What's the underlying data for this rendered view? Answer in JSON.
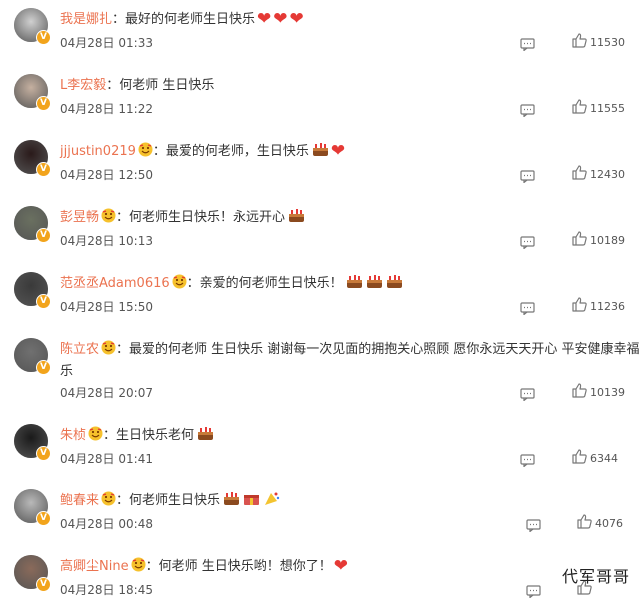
{
  "comments": [
    {
      "username": "我是娜扎",
      "text": "最好的何老师生日快乐",
      "date": "04月28日",
      "time": "01:33",
      "likes": "11530",
      "avatar_color": "#d0d0d0",
      "icons": [
        "heart",
        "heart",
        "heart"
      ],
      "badge": false
    },
    {
      "username": "L李宏毅",
      "text": "何老师 生日快乐",
      "date": "04月28日",
      "time": "11:22",
      "likes": "11555",
      "avatar_color": "#c5b0a0",
      "icons": [],
      "badge": false
    },
    {
      "username": "jjjustin0219",
      "text": "最爱的何老师，生日快乐",
      "date": "04月28日",
      "time": "12:50",
      "likes": "12430",
      "avatar_color": "#2a1a1a",
      "icons": [
        "cake",
        "heart"
      ],
      "badge": true
    },
    {
      "username": "彭昱畅",
      "text": "何老师生日快乐！永远开心",
      "date": "04月28日",
      "time": "10:13",
      "likes": "10189",
      "avatar_color": "#6a7060",
      "icons": [
        "cake"
      ],
      "badge": true
    },
    {
      "username": "范丞丞Adam0616",
      "text": "亲爱的何老师生日快乐！",
      "date": "04月28日",
      "time": "15:50",
      "likes": "11236",
      "avatar_color": "#3a3a3a",
      "icons": [
        "cake",
        "cake",
        "cake"
      ],
      "badge": true
    },
    {
      "username": "陈立农",
      "text": "最爱的何老师 生日快乐 谢谢每一次见面的拥抱关心照顾 愿你永远天天开心 平安健康幸福快",
      "text_wrap": "乐",
      "date": "04月28日",
      "time": "20:07",
      "likes": "10139",
      "avatar_color": "#707070",
      "icons": [],
      "badge": true
    },
    {
      "username": "朱桢",
      "text": "生日快乐老何",
      "date": "04月28日",
      "time": "01:41",
      "likes": "6344",
      "avatar_color": "#1a1a1a",
      "icons": [
        "cake"
      ],
      "badge": true
    },
    {
      "username": "鲍春来",
      "text": "何老师生日快乐",
      "date": "04月28日",
      "time": "00:48",
      "likes": "4076",
      "avatar_color": "#b9b9b9",
      "icons": [
        "cake",
        "gift",
        "party"
      ],
      "badge": true
    },
    {
      "username": "高卿尘Nine",
      "text": "何老师 生日快乐哟！想你了！",
      "date": "04月28日",
      "time": "18:45",
      "likes": "",
      "avatar_color": "#8a6a5a",
      "icons": [
        "heart"
      ],
      "badge": true
    }
  ],
  "icon_names": {
    "comment": "comment-icon",
    "like": "like-icon",
    "heart": "heart-icon",
    "cake": "cake-icon",
    "badge": "verified-badge-icon"
  },
  "colors": {
    "username": "#eb7350",
    "heart": "#e53935",
    "badge": "#f2a41c"
  },
  "watermark": "代军哥哥"
}
